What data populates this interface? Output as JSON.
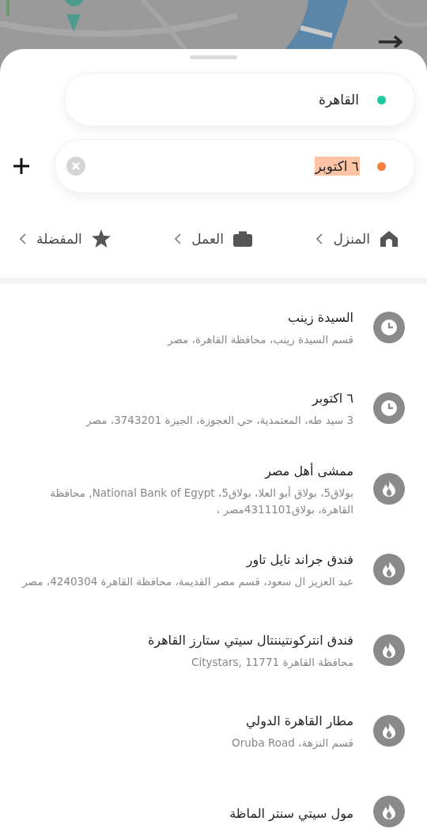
{
  "fields": [
    {
      "value": "القاهرة",
      "color": "#1fc7a3",
      "highlighted": false,
      "clearable": false
    },
    {
      "value": "٦ اكتوبر",
      "color": "#f77e3f",
      "highlighted": true,
      "clearable": true
    }
  ],
  "shortcuts": [
    {
      "kind": "home",
      "label": "المنزل"
    },
    {
      "kind": "work",
      "label": "العمل"
    },
    {
      "kind": "star",
      "label": "المفضلة"
    }
  ],
  "places": [
    {
      "kind": "recent",
      "title": "السيدة زينب",
      "address": "قسم السيدة زينب، محافظة القاهرة، مصر"
    },
    {
      "kind": "recent",
      "title": "٦ اكتوبر",
      "address": "3 سيد طه، المعتمدية، حي العجوزة، الجيزة 3743201، مصر"
    },
    {
      "kind": "popular",
      "title": "ممشى أهل مصر",
      "address": "بولاق5، بولاق أبو العلا، بولاق5، National Bank of Egypt, محافظة القاهرة، بولاق4311101مصر ،"
    },
    {
      "kind": "popular",
      "title": "فندق جراند نايل تاور",
      "address": "عبد العزيز ال سعود، قسم مصر القديمة، محافظة القاهرة 4240304، مصر"
    },
    {
      "kind": "popular",
      "title": "فندق انتركونتيننتال سيتي ستارز القاهرة",
      "address": "محافظة القاهرة Citystars, 11771"
    },
    {
      "kind": "popular",
      "title": "مطار القاهرة الدولي",
      "address": "قسم النزهة، Oruba Road"
    },
    {
      "kind": "popular",
      "title": "مول سيتي سنتر الماظة"
    }
  ]
}
